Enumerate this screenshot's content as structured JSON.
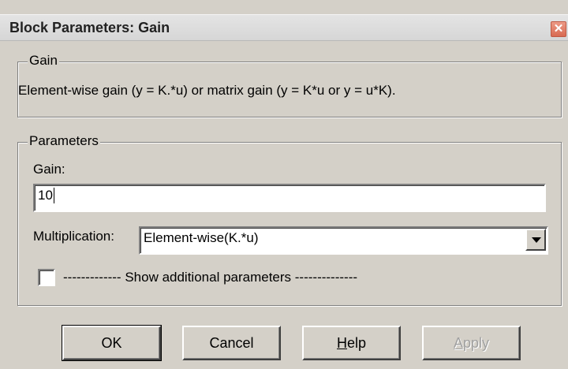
{
  "window": {
    "title": "Block Parameters: Gain",
    "close_glyph": "✕"
  },
  "gain_group": {
    "legend": "Gain",
    "description": "Element-wise gain (y = K.*u) or matrix gain (y = K*u or y = u*K)."
  },
  "parameters_group": {
    "legend": "Parameters",
    "gain_label": "Gain:",
    "gain_value": "10",
    "multiplication_label": "Multiplication:",
    "multiplication_selected": "Element-wise(K.*u)",
    "show_additional_label": "------------- Show additional parameters --------------",
    "show_additional_checked": false
  },
  "buttons": {
    "ok": "OK",
    "cancel": "Cancel",
    "help_mnemonic": "H",
    "help_rest": "elp",
    "apply_mnemonic": "A",
    "apply_rest": "pply",
    "apply_enabled": false
  },
  "icons": {
    "close": "close-icon",
    "dropdown": "chevron-down-icon"
  }
}
